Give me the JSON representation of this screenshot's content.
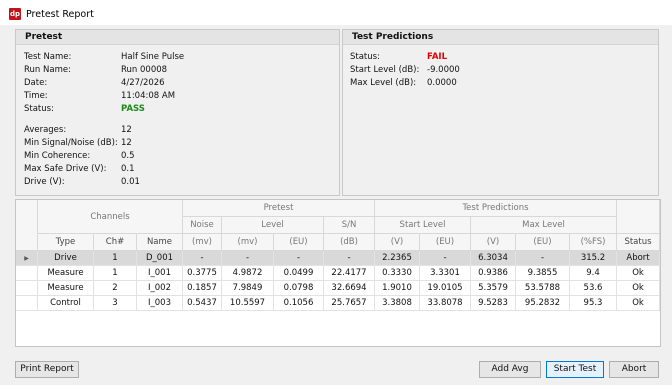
{
  "window": {
    "title": "Pretest Report",
    "icon_text": "dp"
  },
  "pretest": {
    "header": "Pretest",
    "fields": [
      {
        "label": "Test Name:",
        "value": "Half Sine Pulse"
      },
      {
        "label": "Run Name:",
        "value": "Run 00008"
      },
      {
        "label": "Date:",
        "value": "4/27/2026"
      },
      {
        "label": "Time:",
        "value": "11:04:08 AM"
      },
      {
        "label": "Status:",
        "value": "PASS"
      }
    ],
    "params": [
      {
        "label": "Averages:",
        "value": "12"
      },
      {
        "label": "Min Signal/Noise (dB):",
        "value": "12"
      },
      {
        "label": "Min Coherence:",
        "value": "0.5"
      },
      {
        "label": "Max Safe Drive (V):",
        "value": "0.1"
      },
      {
        "label": "Drive (V):",
        "value": "0.01"
      }
    ]
  },
  "predictions": {
    "header": "Test Predictions",
    "fields": [
      {
        "label": "Status:",
        "value": "FAIL"
      },
      {
        "label": "Start Level (dB):",
        "value": "-9.0000"
      },
      {
        "label": "Max Level (dB):",
        "value": "0.0000"
      }
    ]
  },
  "grid": {
    "group_headers": {
      "channels": "Channels",
      "pretest": "Pretest",
      "predictions": "Test Predictions"
    },
    "sub_headers": {
      "noise": "Noise",
      "level": "Level",
      "sn": "S/N",
      "start_level": "Start Level",
      "max_level": "Max Level"
    },
    "columns": [
      "Type",
      "Ch#",
      "Name",
      "(mv)",
      "(mv)",
      "(EU)",
      "(dB)",
      "(V)",
      "(EU)",
      "(V)",
      "(EU)",
      "(%FS)",
      "Status"
    ],
    "rows": [
      [
        "Drive",
        "1",
        "D_001",
        "-",
        "-",
        "-",
        "-",
        "2.2365",
        "-",
        "6.3034",
        "-",
        "315.2",
        "Abort"
      ],
      [
        "Measure",
        "1",
        "I_001",
        "0.3775",
        "4.9872",
        "0.0499",
        "22.4177",
        "0.3330",
        "3.3301",
        "0.9386",
        "9.3855",
        "9.4",
        "Ok"
      ],
      [
        "Measure",
        "2",
        "I_002",
        "0.1857",
        "7.9849",
        "0.0798",
        "32.6694",
        "1.9010",
        "19.0105",
        "5.3579",
        "53.5788",
        "53.6",
        "Ok"
      ],
      [
        "Control",
        "3",
        "I_003",
        "0.5437",
        "10.5597",
        "0.1056",
        "25.7657",
        "3.3808",
        "33.8078",
        "9.5283",
        "95.2832",
        "95.3",
        "Ok"
      ]
    ]
  },
  "buttons": {
    "print": "Print Report",
    "add_avg": "Add Avg",
    "start": "Start Test",
    "abort": "Abort"
  },
  "colors": {
    "fail": "#e00000",
    "pass": "#1a8a1a",
    "icon": "#c0141a"
  }
}
